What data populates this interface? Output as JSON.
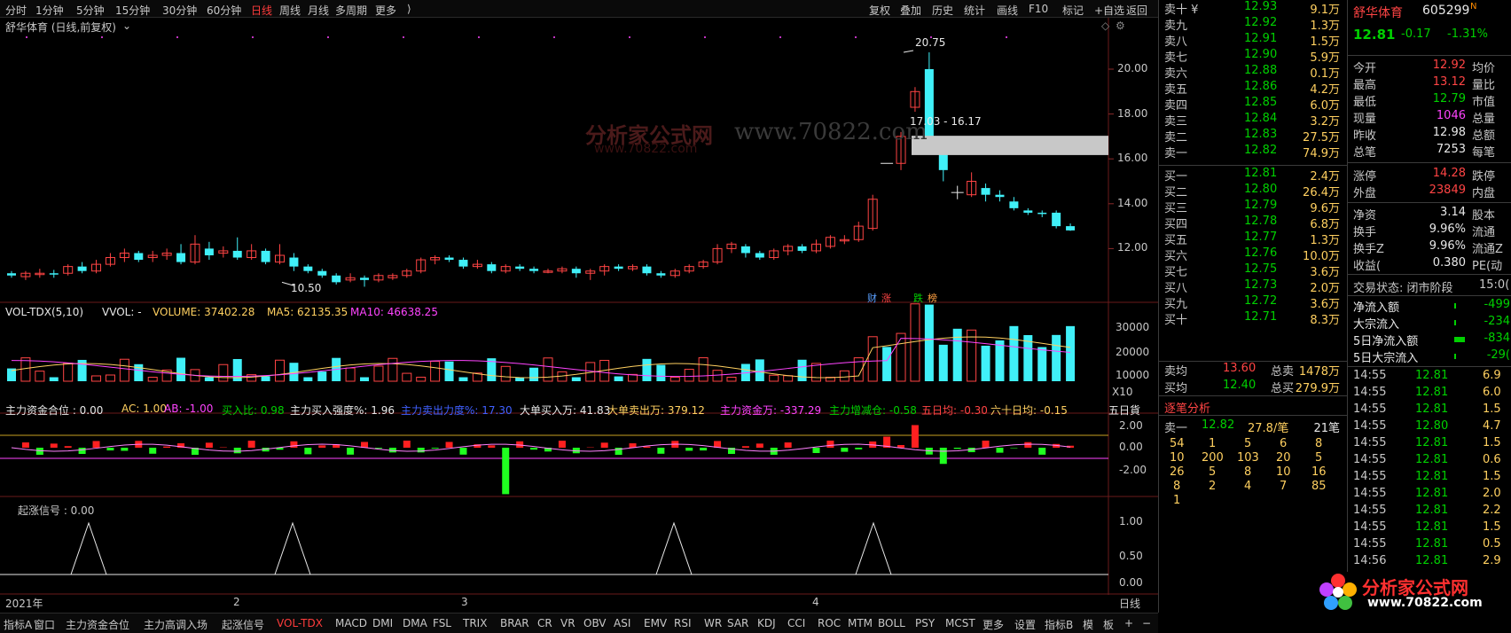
{
  "topbar": {
    "periods": [
      "分时",
      "1分钟",
      "5分钟",
      "15分钟",
      "30分钟",
      "60分钟",
      "日线",
      "周线",
      "月线",
      "多周期",
      "更多"
    ],
    "more_arrow": "⟩",
    "active_period": "日线",
    "right_tools": [
      "复权",
      "叠加",
      "历史",
      "统计",
      "画线",
      "F10",
      "标记",
      "+自选",
      "返回"
    ]
  },
  "main_chart": {
    "title": "舒华体育 (日线,前复权)",
    "y_ticks": [
      "20.00",
      "18.00",
      "16.00",
      "14.00",
      "12.00"
    ],
    "high_label": "20.75",
    "low_label": "10.50",
    "gap_label": "17.03 - 16.17",
    "markers": [
      {
        "text": "财",
        "color": "#5aa0ff"
      },
      {
        "text": "涨",
        "color": "#ff4444"
      },
      {
        "text": "跌",
        "color": "#00d000"
      },
      {
        "text": "榜",
        "color": "#ffa040"
      }
    ],
    "watermark_url": "www.70822.com",
    "watermark_brand": "分析家公式网",
    "watermark_small": "www.70822.com"
  },
  "volume_panel": {
    "name": "VOL-TDX(5,10)",
    "vvol": "VVOL: -",
    "volume": "VOLUME: 37402.28",
    "ma5": "MA5: 62135.35",
    "ma10": "MA10: 46638.25",
    "y_ticks": [
      "30000",
      "20000",
      "10000"
    ],
    "unit": "X10"
  },
  "fund_panel": {
    "items": [
      {
        "text": "主力资金合位 : 0.00",
        "color": "#e8e8e8"
      },
      {
        "text": "AC: 1.00",
        "color": "#ffd060"
      },
      {
        "text": "AB: -1.00",
        "color": "#ff44ff"
      },
      {
        "text": "买入比: 0.98",
        "color": "#00d000"
      },
      {
        "text": "主力买入强度%: 1.96",
        "color": "#e8e8e8"
      },
      {
        "text": "主力卖出力度%: 17.30",
        "color": "#4060ff"
      },
      {
        "text": "大单买入万: 41.83",
        "color": "#e8e8e8"
      },
      {
        "text": "大单卖出万: 379.12",
        "color": "#ffd060"
      },
      {
        "text": "主力资金万: -337.29",
        "color": "#ff44ff"
      },
      {
        "text": "主力增减仓: -0.58",
        "color": "#00d000"
      },
      {
        "text": "五日均: -0.30",
        "color": "#ff4444"
      },
      {
        "text": "六十日均: -0.15",
        "color": "#ffd060"
      }
    ],
    "overflow": "五日貨",
    "y_ticks": [
      "2.00",
      "0.00",
      "-2.00"
    ]
  },
  "signal_panel": {
    "title": "起涨信号 : 0.00",
    "y_ticks": [
      "1.00",
      "0.50",
      "0.00"
    ]
  },
  "x_axis": {
    "labels": [
      "2021年",
      "2",
      "3",
      "4"
    ],
    "period": "日线"
  },
  "bottombar": {
    "left": [
      "指标A",
      "窗口",
      "主力资金合位",
      "主力高调入场",
      "起涨信号",
      "VOL-TDX",
      "MACD",
      "DMI",
      "DMA",
      "FSL",
      "TRIX",
      "BRAR",
      "CR",
      "VR",
      "OBV",
      "ASI",
      "EMV",
      "RSI",
      "WR",
      "SAR",
      "KDJ",
      "CCI",
      "ROC",
      "MTM",
      "BOLL",
      "PSY",
      "MCST",
      "更多",
      "设置"
    ],
    "active": "VOL-TDX",
    "right": [
      "指标B",
      "模",
      "板",
      "+",
      "−"
    ]
  },
  "order_book": {
    "sells": [
      {
        "label": "卖十 ¥",
        "price": "12.93",
        "vol": "9.1万"
      },
      {
        "label": "卖九",
        "price": "12.92",
        "vol": "1.3万"
      },
      {
        "label": "卖八",
        "price": "12.91",
        "vol": "1.5万"
      },
      {
        "label": "卖七",
        "price": "12.90",
        "vol": "5.9万"
      },
      {
        "label": "卖六",
        "price": "12.88",
        "vol": "0.1万"
      },
      {
        "label": "卖五",
        "price": "12.86",
        "vol": "4.2万"
      },
      {
        "label": "卖四",
        "price": "12.85",
        "vol": "6.0万"
      },
      {
        "label": "卖三",
        "price": "12.84",
        "vol": "3.2万"
      },
      {
        "label": "卖二",
        "price": "12.83",
        "vol": "27.5万"
      },
      {
        "label": "卖一",
        "price": "12.82",
        "vol": "74.9万"
      }
    ],
    "buys": [
      {
        "label": "买一",
        "price": "12.81",
        "vol": "2.4万"
      },
      {
        "label": "买二",
        "price": "12.80",
        "vol": "26.4万"
      },
      {
        "label": "买三",
        "price": "12.79",
        "vol": "9.6万"
      },
      {
        "label": "买四",
        "price": "12.78",
        "vol": "6.8万"
      },
      {
        "label": "买五",
        "price": "12.77",
        "vol": "1.3万"
      },
      {
        "label": "买六",
        "price": "12.76",
        "vol": "10.0万"
      },
      {
        "label": "买七",
        "price": "12.75",
        "vol": "3.6万"
      },
      {
        "label": "买八",
        "price": "12.73",
        "vol": "2.0万"
      },
      {
        "label": "买九",
        "price": "12.72",
        "vol": "3.6万"
      },
      {
        "label": "买十",
        "price": "12.71",
        "vol": "8.3万"
      }
    ],
    "avg_sell_label": "卖均",
    "avg_sell": "13.60",
    "total_sell_label": "总卖",
    "total_sell": "1478万",
    "avg_buy_label": "买均",
    "avg_buy": "12.40",
    "total_buy_label": "总买",
    "total_buy": "279.9万",
    "analysis_title": "逐笔分析",
    "sell1_label": "卖一",
    "sell1_price": "12.82",
    "sell1_avg": "27.8/笔",
    "sell1_count": "21笔",
    "queue": [
      [
        "54",
        "1",
        "5",
        "6",
        "8"
      ],
      [
        "10",
        "200",
        "103",
        "20",
        "5"
      ],
      [
        "26",
        "5",
        "8",
        "10",
        "16"
      ],
      [
        "8",
        "2",
        "4",
        "7",
        "85"
      ],
      [
        "1",
        "",
        "",
        "",
        ""
      ]
    ]
  },
  "quote": {
    "name": "舒华体育",
    "code": "605299",
    "badge": "N",
    "price": "12.81",
    "change": "-0.17",
    "pct": "-1.31%",
    "rows1": [
      {
        "l": "今开",
        "v": "12.92",
        "c": "#ff4444",
        "r": "均价"
      },
      {
        "l": "最高",
        "v": "13.12",
        "c": "#ff4444",
        "r": "量比"
      },
      {
        "l": "最低",
        "v": "12.79",
        "c": "#00d000",
        "r": "市值"
      },
      {
        "l": "现量",
        "v": "1046",
        "c": "#ff44ff",
        "r": "总量"
      },
      {
        "l": "昨收",
        "v": "12.98",
        "c": "#e8e8e8",
        "r": "总额"
      },
      {
        "l": "总笔",
        "v": "7253",
        "c": "#e8e8e8",
        "r": "每笔"
      }
    ],
    "rows2": [
      {
        "l": "涨停",
        "v": "14.28",
        "c": "#ff4444",
        "r": "跌停"
      },
      {
        "l": "外盘",
        "v": "23849",
        "c": "#ff4444",
        "r": "内盘"
      }
    ],
    "rows3": [
      {
        "l": "净资",
        "v": "3.14",
        "c": "#e8e8e8",
        "r": "股本"
      },
      {
        "l": "换手",
        "v": "9.96%",
        "c": "#e8e8e8",
        "r": "流通"
      },
      {
        "l": "换手Z",
        "v": "9.96%",
        "c": "#e8e8e8",
        "r": "流通Z"
      },
      {
        "l": "收益(",
        "v": "0.380",
        "c": "#e8e8e8",
        "r": "PE(动"
      }
    ],
    "stage": "交易状态: 闭市阶段",
    "stage_time": "15:0(",
    "flows": [
      {
        "l": "净流入额",
        "v": "-499"
      },
      {
        "l": "大宗流入",
        "v": "-234"
      },
      {
        "l": "5日净流入额",
        "v": "-834"
      },
      {
        "l": "5日大宗流入",
        "v": "-29("
      }
    ],
    "ticks": [
      {
        "t": "14:55",
        "p": "12.81",
        "v": "6.9"
      },
      {
        "t": "14:55",
        "p": "12.81",
        "v": "6.0"
      },
      {
        "t": "14:55",
        "p": "12.81",
        "v": "1.5"
      },
      {
        "t": "14:55",
        "p": "12.80",
        "v": "4.7"
      },
      {
        "t": "14:55",
        "p": "12.81",
        "v": "1.5"
      },
      {
        "t": "14:55",
        "p": "12.81",
        "v": "0.6"
      },
      {
        "t": "14:55",
        "p": "12.81",
        "v": "1.5"
      },
      {
        "t": "14:55",
        "p": "12.81",
        "v": "2.0"
      },
      {
        "t": "14:55",
        "p": "12.81",
        "v": "2.2"
      },
      {
        "t": "14:55",
        "p": "12.81",
        "v": "1.5"
      },
      {
        "t": "14:55",
        "p": "12.81",
        "v": "0.5"
      },
      {
        "t": "14:56",
        "p": "12.81",
        "v": "2.9"
      },
      {
        "t": "14:56",
        "p": "12.81",
        "v": "5.4"
      }
    ]
  },
  "promo": {
    "brand": "分析家公式网",
    "url": "www.70822.com"
  },
  "colors": {
    "up": "#ff4444",
    "down": "#40f0f8",
    "ma5": "#e8e8e8",
    "ma10": "#ffd060",
    "ma20": "#ff44ff"
  }
}
